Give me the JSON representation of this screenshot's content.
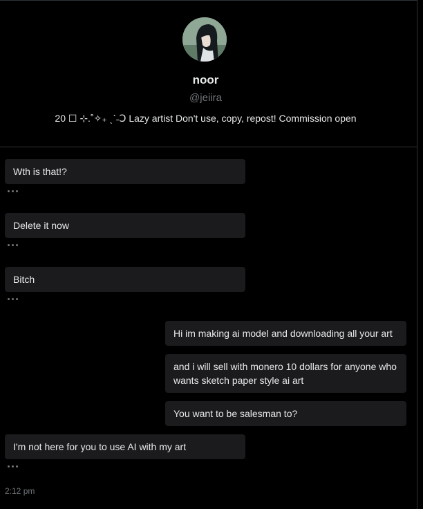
{
  "profile": {
    "name": "noor",
    "handle": "@jeiira",
    "bio": "20 ☐ ⊹.˚✧₊ ˎˊ˗Ↄ Lazy artist Don't use, copy, repost! Commission open"
  },
  "messages": [
    {
      "side": "left",
      "text": "Wth is that!?"
    },
    {
      "side": "left",
      "text": "Delete it now"
    },
    {
      "side": "left",
      "text": "Bitch"
    },
    {
      "side": "right",
      "text": "Hi im making ai model and downloading all your art"
    },
    {
      "side": "right",
      "text": "and i will sell with monero 10 dollars for anyone who wants sketch paper style ai art"
    },
    {
      "side": "right",
      "text": "You want to be salesman to?"
    },
    {
      "side": "left",
      "text": "I'm not here for you to use AI with my art"
    }
  ],
  "timestamp": "2:12 pm",
  "icons": {
    "more": "more-horizontal-icon",
    "avatar": "profile-avatar"
  }
}
